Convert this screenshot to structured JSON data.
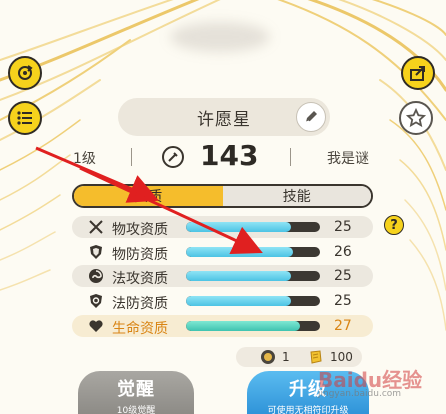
{
  "header": {
    "hero_name": "许愿星",
    "level": "1级",
    "power": "143",
    "nickname": "我是谜"
  },
  "tabs": [
    {
      "label": "资质",
      "active": true
    },
    {
      "label": "技能",
      "active": false
    }
  ],
  "attributes": [
    {
      "label": "物攻资质",
      "value": "25",
      "fill": 0.78,
      "icon": "swords-icon",
      "highlight": false
    },
    {
      "label": "物防资质",
      "value": "26",
      "fill": 0.8,
      "icon": "shield-icon",
      "highlight": false
    },
    {
      "label": "法攻资质",
      "value": "25",
      "fill": 0.78,
      "icon": "magic-swirl-icon",
      "highlight": false
    },
    {
      "label": "法防资质",
      "value": "25",
      "fill": 0.78,
      "icon": "magic-shield-icon",
      "highlight": false
    },
    {
      "label": "生命资质",
      "value": "27",
      "fill": 0.85,
      "icon": "heart-icon",
      "highlight": true
    }
  ],
  "resources": {
    "item1_count": "1",
    "item2_count": "100"
  },
  "buttons": {
    "awaken_label": "觉醒",
    "awaken_sub": "10级觉醒",
    "upgrade_label": "升级",
    "upgrade_sub": "可使用无相符印升级"
  },
  "watermark": {
    "main": "Baidu经验",
    "sub": "jingyan.baidu.com"
  },
  "colors": {
    "accent_yellow": "#f6d21c",
    "tab_active": "#f5bd2c",
    "bar_fill": "#4cc3e4",
    "life_bar_fill": "#3fc3b0",
    "life_text": "#d98515",
    "upgrade_blue": "#2a8fd6",
    "arrow_red": "#e02020"
  }
}
